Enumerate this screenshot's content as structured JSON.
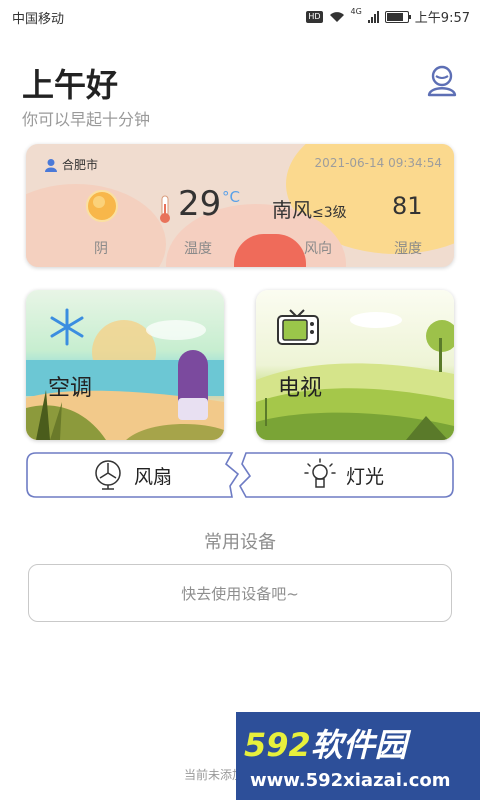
{
  "status_bar": {
    "carrier": "中国移动",
    "hd_badge": "HD",
    "network": "4G",
    "time": "上午9:57"
  },
  "header": {
    "greeting": "上午好",
    "subtitle": "你可以早起十分钟",
    "profile_icon": "profile-icon"
  },
  "weather": {
    "city": "合肥市",
    "datetime": "2021-06-14 09:34:54",
    "condition": "阴",
    "temperature": "29",
    "temp_unit": "°C",
    "wind_direction": "南风",
    "wind_level": "≤3级",
    "humidity": "81",
    "labels": {
      "condition": "阴",
      "temperature": "温度",
      "wind": "风向",
      "humidity": "湿度"
    },
    "colors": {
      "card": "#f0dccf",
      "accent_yellow": "#fbd98e",
      "accent_red": "#ef6b5a",
      "unit_blue": "#5aa1e8"
    }
  },
  "devices": {
    "air_conditioner": "空调",
    "tv": "电视",
    "fan": "风扇",
    "light": "灯光"
  },
  "common_devices": {
    "title": "常用设备",
    "empty_text": "快去使用设备吧~"
  },
  "footer": {
    "text": "当前未添加"
  },
  "watermark": {
    "brand_num": "592",
    "brand_text": "软件园",
    "url": "www.592xiazai.com"
  }
}
